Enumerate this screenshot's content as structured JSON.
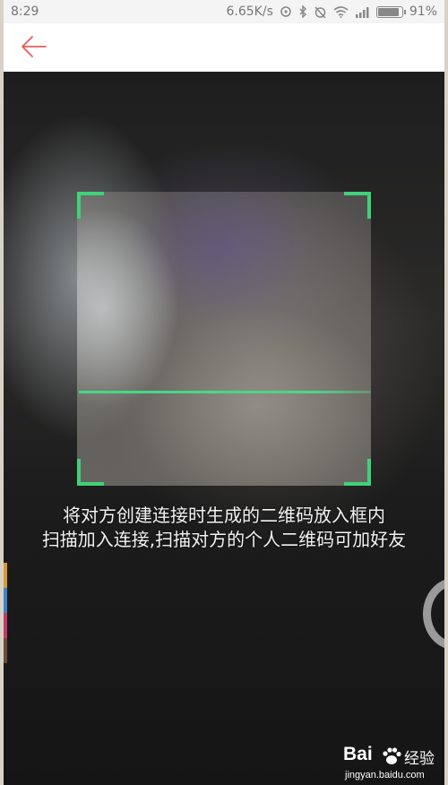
{
  "status_bar": {
    "time": "8:29",
    "speed": "6.65K/s",
    "battery": "91%",
    "battery_level": 0.91,
    "icons": [
      "sync-icon",
      "bluetooth-icon",
      "alarm-off-icon",
      "wifi-icon",
      "signal-icon",
      "battery-icon"
    ]
  },
  "header": {
    "back_icon": "back-arrow-icon",
    "accent_color": "#e85c5c"
  },
  "scanner": {
    "corner_color": "#3fd27a",
    "instruction_line1": "将对方创建连接时生成的二维码放入框内",
    "instruction_line2": "扫描加入连接,扫描对方的个人二维码可加好友"
  },
  "watermark": {
    "brand": "Bai",
    "brand_suffix": "经验",
    "url": "jingyan.baidu.com"
  }
}
